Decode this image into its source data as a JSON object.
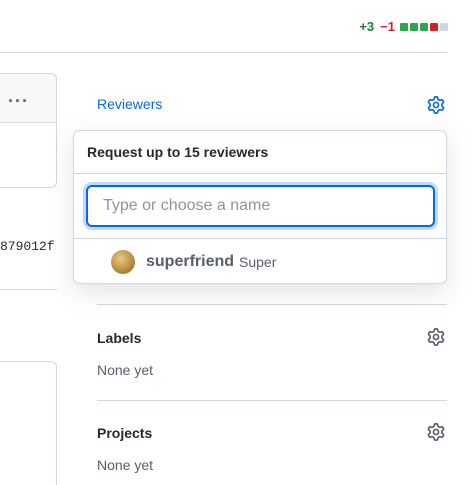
{
  "diffstat": {
    "additions": "+3",
    "deletions": "−1",
    "blocks": [
      "#2da44e",
      "#2da44e",
      "#2da44e",
      "#cf222e",
      "#d0d7de"
    ]
  },
  "left": {
    "sha_fragment": "879012f",
    "menu_glyph": "···"
  },
  "sidebar": {
    "reviewers": {
      "title": "Reviewers"
    },
    "labels": {
      "title": "Labels",
      "value": "None yet"
    },
    "projects": {
      "title": "Projects",
      "value": "None yet"
    }
  },
  "reviewer_popover": {
    "header": "Request up to 15 reviewers",
    "filter_placeholder": "Type or choose a name",
    "filter_value": "",
    "suggestions": [
      {
        "login": "superfriend",
        "name": "Super"
      }
    ]
  },
  "colors": {
    "accent": "#0969da",
    "border": "#d0d7de",
    "muted_text": "#57606a"
  }
}
